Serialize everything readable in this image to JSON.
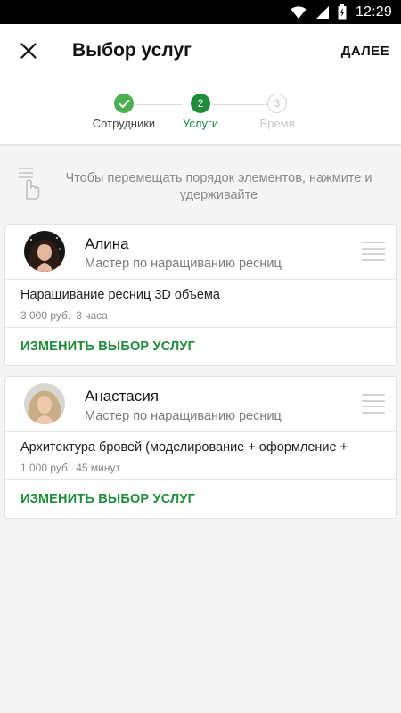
{
  "status_bar": {
    "time": "12:29",
    "icons": [
      "wifi-icon",
      "signal-icon",
      "battery-charging-icon"
    ]
  },
  "header": {
    "close_icon": "close-icon",
    "title": "Выбор услуг",
    "next_label": "ДАЛЕЕ"
  },
  "stepper": {
    "steps": [
      {
        "marker": "✓",
        "label": "Сотрудники",
        "state": "done"
      },
      {
        "marker": "2",
        "label": "Услуги",
        "state": "active"
      },
      {
        "marker": "3",
        "label": "Время",
        "state": "future"
      }
    ]
  },
  "hint": {
    "icon": "touch-drag-icon",
    "text": "Чтобы перемещать порядок элементов, нажмите и удерживайте"
  },
  "cards": [
    {
      "name": "Алина",
      "role": "Мастер по наращиванию ресниц",
      "service": "Наращивание ресниц 3D объема",
      "price": "3 000 руб.",
      "duration": "3 часа",
      "action": "ИЗМЕНИТЬ ВЫБОР УСЛУГ"
    },
    {
      "name": "Анастасия",
      "role": "Мастер по наращиванию ресниц",
      "service": "Архитектура бровей (моделирование + оформление +",
      "price": "1 000 руб.",
      "duration": "45 минут",
      "action": "ИЗМЕНИТЬ ВЫБОР УСЛУГ"
    }
  ],
  "colors": {
    "accent": "#1e8c3a",
    "check": "#4caf50",
    "background": "#f5f5f5"
  }
}
